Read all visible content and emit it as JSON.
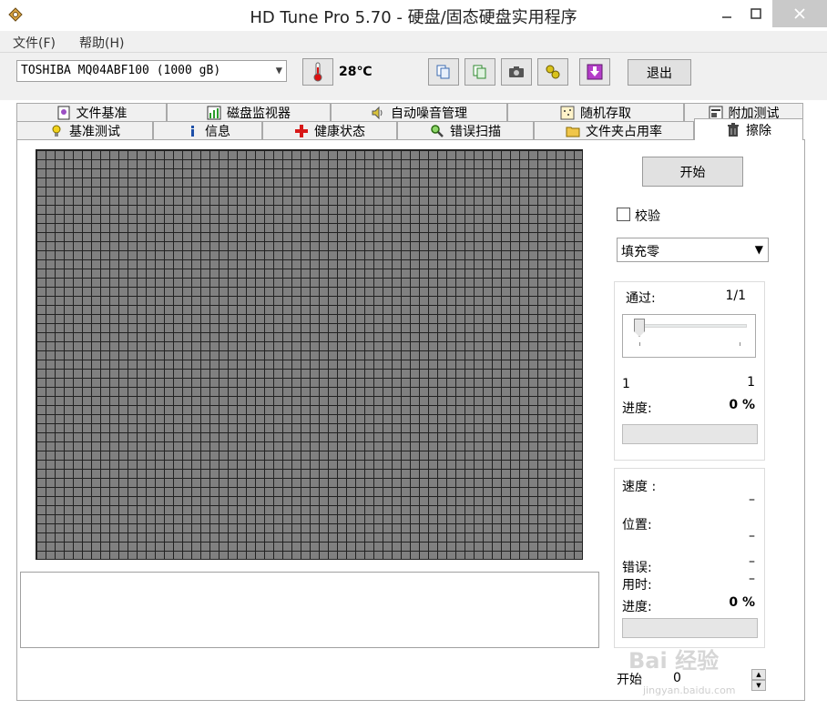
{
  "window": {
    "title": "HD Tune Pro 5.70 - 硬盘/固态硬盘实用程序"
  },
  "menu": {
    "items": [
      {
        "label": "文件(F)"
      },
      {
        "label": "帮助(H)"
      }
    ]
  },
  "toolbar": {
    "drive": "TOSHIBA MQ04ABF100 (1000 gB)",
    "temperature": "28℃",
    "exit_label": "退出"
  },
  "tabs_row1": [
    {
      "label": "文件基准"
    },
    {
      "label": "磁盘监视器"
    },
    {
      "label": "自动噪音管理"
    },
    {
      "label": "随机存取"
    },
    {
      "label": "附加测试"
    }
  ],
  "tabs_row2": [
    {
      "label": "基准测试"
    },
    {
      "label": "信息"
    },
    {
      "label": "健康状态"
    },
    {
      "label": "错误扫描"
    },
    {
      "label": "文件夹占用率"
    },
    {
      "label": "擦除"
    }
  ],
  "erase": {
    "start_label": "开始",
    "verify_label": "校验",
    "fill_mode": "填充零",
    "pass_label": "通过:",
    "pass_value": "1/1",
    "slider_min": "1",
    "slider_max": "1",
    "progress_label": "进度:",
    "progress_value": "0 %",
    "progress_fraction": 0,
    "speed_label": "速度 :",
    "speed_value": "–",
    "position_label": "位置:",
    "position_value": "–",
    "error_label": "错误:",
    "error_value": "–",
    "time_label": "用时:",
    "time_value": "–",
    "progress2_label": "进度:",
    "progress2_value": "0 %",
    "start_pos_label": "开始",
    "start_pos_value": "0"
  },
  "watermark": {
    "text": "Bai 经验",
    "url": "jingyan.baidu.com"
  }
}
